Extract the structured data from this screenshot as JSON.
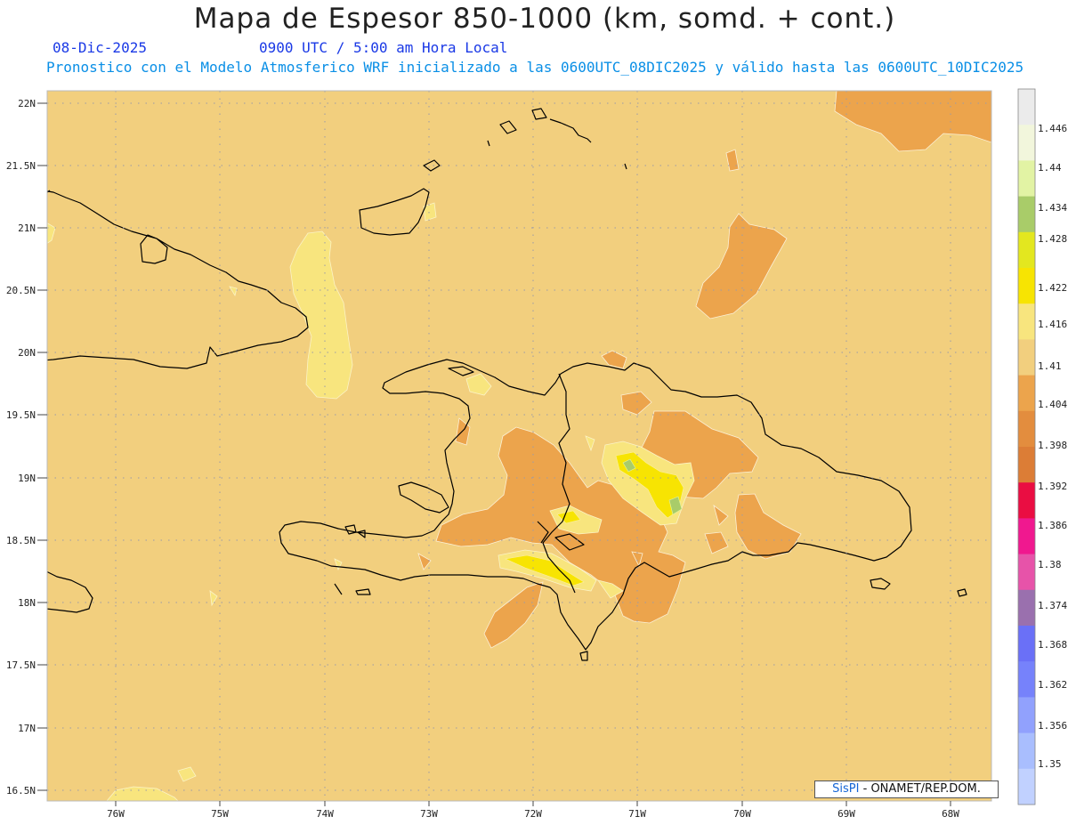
{
  "header": {
    "title": "Mapa de Espesor 850-1000 (km, somd. + cont.)",
    "date": "08-Dic-2025",
    "time": "0900 UTC / 5:00 am Hora Local",
    "forecast": "Pronostico con el Modelo Atmosferico WRF inicializado a las 0600UTC_08DIC2025 y válido hasta las  0600UTC_10DIC2025"
  },
  "axes": {
    "lat_labels": [
      "22N",
      "21.5N",
      "21N",
      "20.5N",
      "20N",
      "19.5N",
      "19N",
      "18.5N",
      "18N",
      "17.5N",
      "17N",
      "16.5N"
    ],
    "lon_labels": [
      "76W",
      "75W",
      "74W",
      "73W",
      "72W",
      "71W",
      "70W",
      "69W",
      "68W"
    ]
  },
  "colorbar": {
    "labels": [
      "1.446",
      "1.44",
      "1.434",
      "1.428",
      "1.422",
      "1.416",
      "1.41",
      "1.404",
      "1.398",
      "1.392",
      "1.386",
      "1.38",
      "1.374",
      "1.368",
      "1.362",
      "1.356",
      "1.35"
    ],
    "colors_top_to_bottom": [
      "#ebebeb",
      "#f2f6dc",
      "#e2f3a4",
      "#a9cc69",
      "#e3e71f",
      "#f7e402",
      "#f8e57e",
      "#f2cf7e",
      "#eca44c",
      "#e38d3e",
      "#dc7d36",
      "#ea0d42",
      "#f0188f",
      "#e753a9",
      "#9a70ae",
      "#6a70f7",
      "#7682fb",
      "#91a1fd",
      "#a9befe",
      "#c1d1ff"
    ]
  },
  "credit": {
    "brand": "SisPI",
    "org": " - ONAMET/REP.DOM."
  },
  "colors": {
    "background_field": "#f2cf7e",
    "low_field": "#eca44c",
    "high_field": "#f8e57e",
    "higher_field": "#f7e402",
    "highest_field": "#a9cc69",
    "coast": "#000000",
    "grid": "#9a9aa8"
  }
}
